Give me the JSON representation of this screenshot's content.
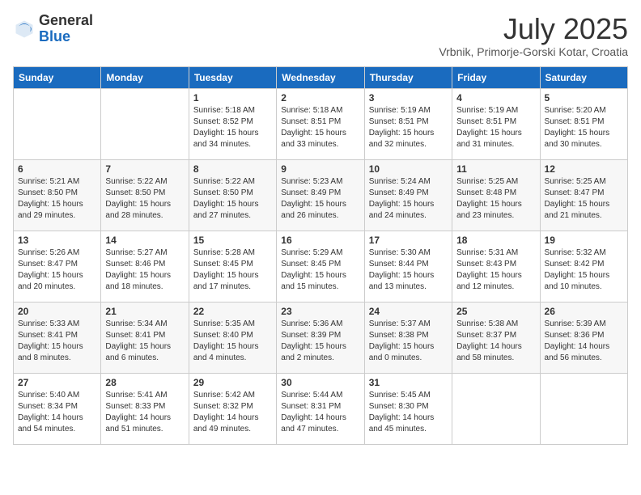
{
  "header": {
    "logo_general": "General",
    "logo_blue": "Blue",
    "month_title": "July 2025",
    "location": "Vrbnik, Primorje-Gorski Kotar, Croatia"
  },
  "columns": [
    "Sunday",
    "Monday",
    "Tuesday",
    "Wednesday",
    "Thursday",
    "Friday",
    "Saturday"
  ],
  "weeks": [
    [
      {
        "day": "",
        "sunrise": "",
        "sunset": "",
        "daylight": ""
      },
      {
        "day": "",
        "sunrise": "",
        "sunset": "",
        "daylight": ""
      },
      {
        "day": "1",
        "sunrise": "Sunrise: 5:18 AM",
        "sunset": "Sunset: 8:52 PM",
        "daylight": "Daylight: 15 hours and 34 minutes."
      },
      {
        "day": "2",
        "sunrise": "Sunrise: 5:18 AM",
        "sunset": "Sunset: 8:51 PM",
        "daylight": "Daylight: 15 hours and 33 minutes."
      },
      {
        "day": "3",
        "sunrise": "Sunrise: 5:19 AM",
        "sunset": "Sunset: 8:51 PM",
        "daylight": "Daylight: 15 hours and 32 minutes."
      },
      {
        "day": "4",
        "sunrise": "Sunrise: 5:19 AM",
        "sunset": "Sunset: 8:51 PM",
        "daylight": "Daylight: 15 hours and 31 minutes."
      },
      {
        "day": "5",
        "sunrise": "Sunrise: 5:20 AM",
        "sunset": "Sunset: 8:51 PM",
        "daylight": "Daylight: 15 hours and 30 minutes."
      }
    ],
    [
      {
        "day": "6",
        "sunrise": "Sunrise: 5:21 AM",
        "sunset": "Sunset: 8:50 PM",
        "daylight": "Daylight: 15 hours and 29 minutes."
      },
      {
        "day": "7",
        "sunrise": "Sunrise: 5:22 AM",
        "sunset": "Sunset: 8:50 PM",
        "daylight": "Daylight: 15 hours and 28 minutes."
      },
      {
        "day": "8",
        "sunrise": "Sunrise: 5:22 AM",
        "sunset": "Sunset: 8:50 PM",
        "daylight": "Daylight: 15 hours and 27 minutes."
      },
      {
        "day": "9",
        "sunrise": "Sunrise: 5:23 AM",
        "sunset": "Sunset: 8:49 PM",
        "daylight": "Daylight: 15 hours and 26 minutes."
      },
      {
        "day": "10",
        "sunrise": "Sunrise: 5:24 AM",
        "sunset": "Sunset: 8:49 PM",
        "daylight": "Daylight: 15 hours and 24 minutes."
      },
      {
        "day": "11",
        "sunrise": "Sunrise: 5:25 AM",
        "sunset": "Sunset: 8:48 PM",
        "daylight": "Daylight: 15 hours and 23 minutes."
      },
      {
        "day": "12",
        "sunrise": "Sunrise: 5:25 AM",
        "sunset": "Sunset: 8:47 PM",
        "daylight": "Daylight: 15 hours and 21 minutes."
      }
    ],
    [
      {
        "day": "13",
        "sunrise": "Sunrise: 5:26 AM",
        "sunset": "Sunset: 8:47 PM",
        "daylight": "Daylight: 15 hours and 20 minutes."
      },
      {
        "day": "14",
        "sunrise": "Sunrise: 5:27 AM",
        "sunset": "Sunset: 8:46 PM",
        "daylight": "Daylight: 15 hours and 18 minutes."
      },
      {
        "day": "15",
        "sunrise": "Sunrise: 5:28 AM",
        "sunset": "Sunset: 8:45 PM",
        "daylight": "Daylight: 15 hours and 17 minutes."
      },
      {
        "day": "16",
        "sunrise": "Sunrise: 5:29 AM",
        "sunset": "Sunset: 8:45 PM",
        "daylight": "Daylight: 15 hours and 15 minutes."
      },
      {
        "day": "17",
        "sunrise": "Sunrise: 5:30 AM",
        "sunset": "Sunset: 8:44 PM",
        "daylight": "Daylight: 15 hours and 13 minutes."
      },
      {
        "day": "18",
        "sunrise": "Sunrise: 5:31 AM",
        "sunset": "Sunset: 8:43 PM",
        "daylight": "Daylight: 15 hours and 12 minutes."
      },
      {
        "day": "19",
        "sunrise": "Sunrise: 5:32 AM",
        "sunset": "Sunset: 8:42 PM",
        "daylight": "Daylight: 15 hours and 10 minutes."
      }
    ],
    [
      {
        "day": "20",
        "sunrise": "Sunrise: 5:33 AM",
        "sunset": "Sunset: 8:41 PM",
        "daylight": "Daylight: 15 hours and 8 minutes."
      },
      {
        "day": "21",
        "sunrise": "Sunrise: 5:34 AM",
        "sunset": "Sunset: 8:41 PM",
        "daylight": "Daylight: 15 hours and 6 minutes."
      },
      {
        "day": "22",
        "sunrise": "Sunrise: 5:35 AM",
        "sunset": "Sunset: 8:40 PM",
        "daylight": "Daylight: 15 hours and 4 minutes."
      },
      {
        "day": "23",
        "sunrise": "Sunrise: 5:36 AM",
        "sunset": "Sunset: 8:39 PM",
        "daylight": "Daylight: 15 hours and 2 minutes."
      },
      {
        "day": "24",
        "sunrise": "Sunrise: 5:37 AM",
        "sunset": "Sunset: 8:38 PM",
        "daylight": "Daylight: 15 hours and 0 minutes."
      },
      {
        "day": "25",
        "sunrise": "Sunrise: 5:38 AM",
        "sunset": "Sunset: 8:37 PM",
        "daylight": "Daylight: 14 hours and 58 minutes."
      },
      {
        "day": "26",
        "sunrise": "Sunrise: 5:39 AM",
        "sunset": "Sunset: 8:36 PM",
        "daylight": "Daylight: 14 hours and 56 minutes."
      }
    ],
    [
      {
        "day": "27",
        "sunrise": "Sunrise: 5:40 AM",
        "sunset": "Sunset: 8:34 PM",
        "daylight": "Daylight: 14 hours and 54 minutes."
      },
      {
        "day": "28",
        "sunrise": "Sunrise: 5:41 AM",
        "sunset": "Sunset: 8:33 PM",
        "daylight": "Daylight: 14 hours and 51 minutes."
      },
      {
        "day": "29",
        "sunrise": "Sunrise: 5:42 AM",
        "sunset": "Sunset: 8:32 PM",
        "daylight": "Daylight: 14 hours and 49 minutes."
      },
      {
        "day": "30",
        "sunrise": "Sunrise: 5:44 AM",
        "sunset": "Sunset: 8:31 PM",
        "daylight": "Daylight: 14 hours and 47 minutes."
      },
      {
        "day": "31",
        "sunrise": "Sunrise: 5:45 AM",
        "sunset": "Sunset: 8:30 PM",
        "daylight": "Daylight: 14 hours and 45 minutes."
      },
      {
        "day": "",
        "sunrise": "",
        "sunset": "",
        "daylight": ""
      },
      {
        "day": "",
        "sunrise": "",
        "sunset": "",
        "daylight": ""
      }
    ]
  ]
}
